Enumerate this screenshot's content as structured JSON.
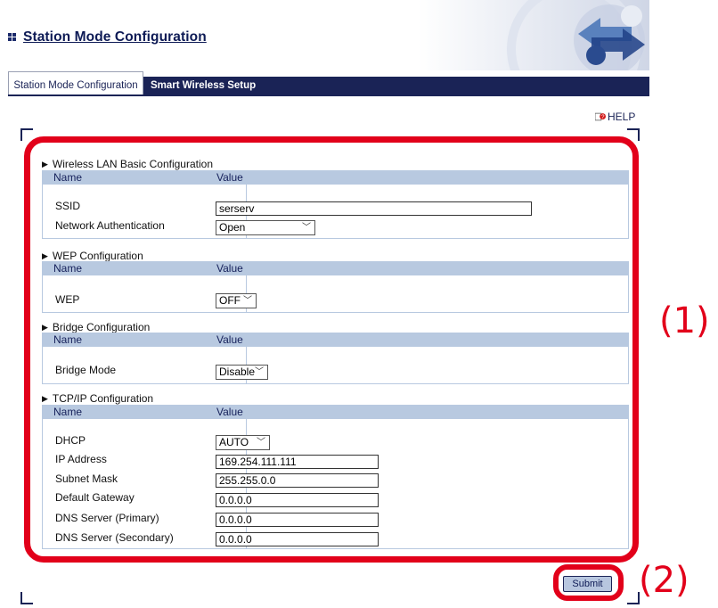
{
  "header": {
    "title": "Station Mode Configuration"
  },
  "tabs": [
    {
      "label": "Station Mode Configuration",
      "active": true
    },
    {
      "label": "Smart Wireless Setup",
      "active": false
    }
  ],
  "help": {
    "label": "HELP"
  },
  "columns": {
    "name": "Name",
    "value": "Value"
  },
  "sections": {
    "wlan": {
      "title": "Wireless LAN Basic Configuration",
      "ssid_label": "SSID",
      "ssid_value": "serserv",
      "auth_label": "Network Authentication",
      "auth_value": "Open"
    },
    "wep": {
      "title": "WEP Configuration",
      "wep_label": "WEP",
      "wep_value": "OFF"
    },
    "bridge": {
      "title": "Bridge Configuration",
      "mode_label": "Bridge Mode",
      "mode_value": "Disable"
    },
    "tcpip": {
      "title": "TCP/IP Configuration",
      "dhcp_label": "DHCP",
      "dhcp_value": "AUTO",
      "ip_label": "IP Address",
      "ip_value": "169.254.111.111",
      "mask_label": "Subnet Mask",
      "mask_value": "255.255.0.0",
      "gateway_label": "Default Gateway",
      "gateway_value": "0.0.0.0",
      "dns1_label": "DNS Server (Primary)",
      "dns1_value": "0.0.0.0",
      "dns2_label": "DNS Server (Secondary)",
      "dns2_value": "0.0.0.0"
    }
  },
  "submit_label": "Submit",
  "annotations": {
    "label_1": "(1)",
    "label_2": "(2)",
    "color": "#e2001a"
  },
  "colors": {
    "navy": "#1a2356",
    "header_row": "#b8c9e0"
  }
}
